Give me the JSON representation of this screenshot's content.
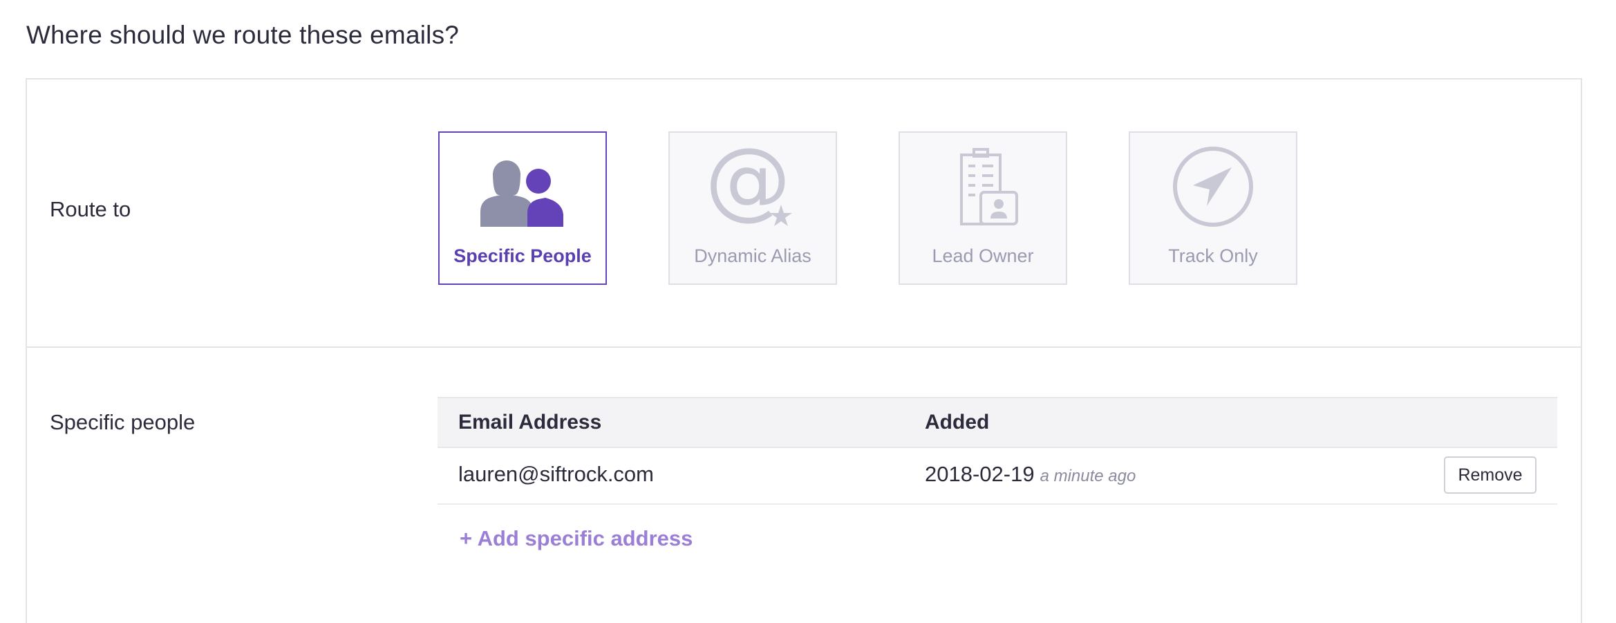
{
  "page": {
    "heading": "Where should we route these emails?"
  },
  "route": {
    "label": "Route to",
    "options": [
      {
        "label": "Specific People",
        "icon": "people-icon",
        "selected": true
      },
      {
        "label": "Dynamic Alias",
        "icon": "at-star-icon",
        "selected": false
      },
      {
        "label": "Lead Owner",
        "icon": "building-contact-icon",
        "selected": false
      },
      {
        "label": "Track Only",
        "icon": "navigation-arrow-icon",
        "selected": false
      }
    ]
  },
  "people": {
    "label": "Specific people",
    "columns": [
      "Email Address",
      "Added"
    ],
    "rows": [
      {
        "email": "lauren@siftrock.com",
        "added_date": "2018-02-19",
        "added_relative": "a minute ago",
        "remove_label": "Remove"
      }
    ],
    "add_label": "+ Add specific address"
  },
  "colors": {
    "accent": "#6442b8",
    "accent_light": "#9b7fd6",
    "inactive_icon": "#c9c9d6",
    "border": "#e3e3e8"
  }
}
